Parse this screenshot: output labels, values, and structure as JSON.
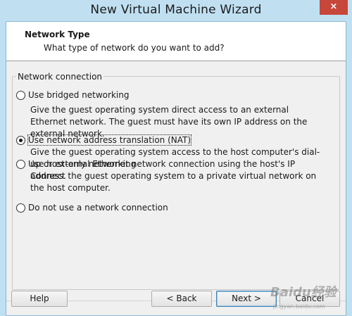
{
  "window": {
    "title": "New Virtual Machine Wizard",
    "close_glyph": "×"
  },
  "header": {
    "title": "Network Type",
    "subtitle": "What type of network do you want to add?"
  },
  "group": {
    "label": "Network connection"
  },
  "options": [
    {
      "label": "Use bridged networking",
      "description": "Give the guest operating system direct access to an external Ethernet network. The guest must have its own IP address on the external network.",
      "selected": false
    },
    {
      "label": "Use network address translation (NAT)",
      "description": "Give the guest operating system access to the host computer's dial-up or external Ethernet network connection using the host's IP address.",
      "selected": true
    },
    {
      "label": "Use host-only networking",
      "description": "Connect the guest operating system to a private virtual network on the host computer.",
      "selected": false
    },
    {
      "label": "Do not use a network connection",
      "description": "",
      "selected": false
    }
  ],
  "buttons": {
    "help": "Help",
    "back": "< Back",
    "next": "Next >",
    "cancel": "Cancel"
  },
  "watermark": {
    "text": "Baidu经验",
    "sub": "jingyan.baidu.com"
  }
}
